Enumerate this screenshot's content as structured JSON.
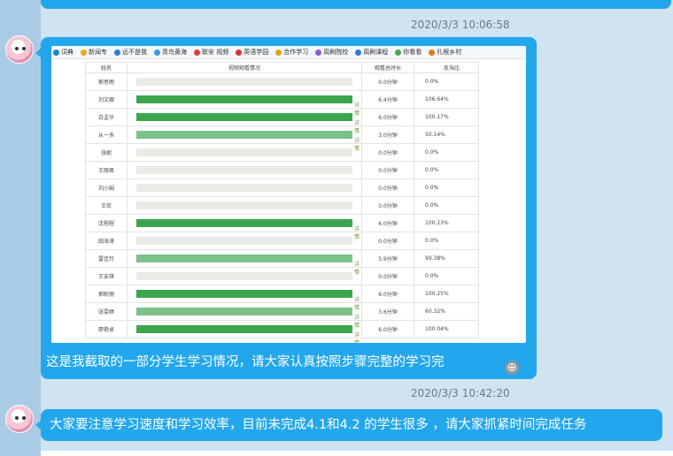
{
  "chat": {
    "timestamp1": "2020/3/3 10:06:58",
    "timestamp2": "2020/3/3 10:42:20",
    "message1_caption": "这是我截取的一部分学生学习情况，请大家认真按照步骤完整的学习完",
    "message2_text": "大家要注意学习速度和学习效率，目前未完成4.1和4.2 的学生很多 ，请大家抓紧时间完成任务"
  },
  "screenshot": {
    "bookmarks": [
      {
        "label": "词典",
        "color": "#2b7bd6"
      },
      {
        "label": "新闻专",
        "color": "#f0a020"
      },
      {
        "label": "远不是我",
        "color": "#2b7bd6"
      },
      {
        "label": "青鸟黄海",
        "color": "#3a9be0"
      },
      {
        "label": "联安 视频",
        "color": "#e23b3b"
      },
      {
        "label": "英语学园",
        "color": "#d9342b"
      },
      {
        "label": "合作学习",
        "color": "#e8a317"
      },
      {
        "label": "周刷院校",
        "color": "#8c5bd6"
      },
      {
        "label": "周刷课程",
        "color": "#2b7bd6"
      },
      {
        "label": "你看看",
        "color": "#4aa84a"
      },
      {
        "label": "扎根乡村",
        "color": "#e07a20"
      }
    ],
    "detail_label": "详情",
    "table": {
      "headers": [
        "姓名",
        "视频观看情况",
        "观看总时长",
        "反刍比"
      ],
      "rows": [
        {
          "name": "郭思雨",
          "duration": "0.0分钟",
          "ratio": "0.0%",
          "progress": 0,
          "detail": false,
          "tone": "dark"
        },
        {
          "name": "刘文娜",
          "duration": "6.4分钟",
          "ratio": "106.64%",
          "progress": 1,
          "detail": true,
          "tone": "dark"
        },
        {
          "name": "白孟华",
          "duration": "6.0分钟",
          "ratio": "100.17%",
          "progress": 1,
          "detail": true,
          "tone": "dark"
        },
        {
          "name": "从一多",
          "duration": "3.0分钟",
          "ratio": "50.14%",
          "progress": 1,
          "detail": true,
          "tone": "light"
        },
        {
          "name": "张妮",
          "duration": "0.0分钟",
          "ratio": "0.0%",
          "progress": 0,
          "detail": false,
          "tone": "dark"
        },
        {
          "name": "王丽君",
          "duration": "0.0分钟",
          "ratio": "0.0%",
          "progress": 0,
          "detail": false,
          "tone": "dark"
        },
        {
          "name": "刘小娟",
          "duration": "0.0分钟",
          "ratio": "0.0%",
          "progress": 0,
          "detail": false,
          "tone": "dark"
        },
        {
          "name": "王欢",
          "duration": "0.0分钟",
          "ratio": "0.0%",
          "progress": 0,
          "detail": false,
          "tone": "dark"
        },
        {
          "name": "沈程程",
          "duration": "6.0分钟",
          "ratio": "100.23%",
          "progress": 1,
          "detail": true,
          "tone": "dark"
        },
        {
          "name": "田海涛",
          "duration": "0.0分钟",
          "ratio": "0.0%",
          "progress": 0,
          "detail": false,
          "tone": "dark"
        },
        {
          "name": "雷佳玲",
          "duration": "5.9分钟",
          "ratio": "99.38%",
          "progress": 1,
          "detail": true,
          "tone": "light"
        },
        {
          "name": "王安琪",
          "duration": "0.0分钟",
          "ratio": "0.0%",
          "progress": 0,
          "detail": false,
          "tone": "dark"
        },
        {
          "name": "郭盼丽",
          "duration": "6.0分钟",
          "ratio": "100.25%",
          "progress": 1,
          "detail": true,
          "tone": "dark"
        },
        {
          "name": "张雯婷",
          "duration": "3.6分钟",
          "ratio": "60.32%",
          "progress": 1,
          "detail": true,
          "tone": "light"
        },
        {
          "name": "廖艳卓",
          "duration": "6.0分钟",
          "ratio": "100.04%",
          "progress": 1,
          "detail": true,
          "tone": "dark"
        }
      ]
    }
  }
}
